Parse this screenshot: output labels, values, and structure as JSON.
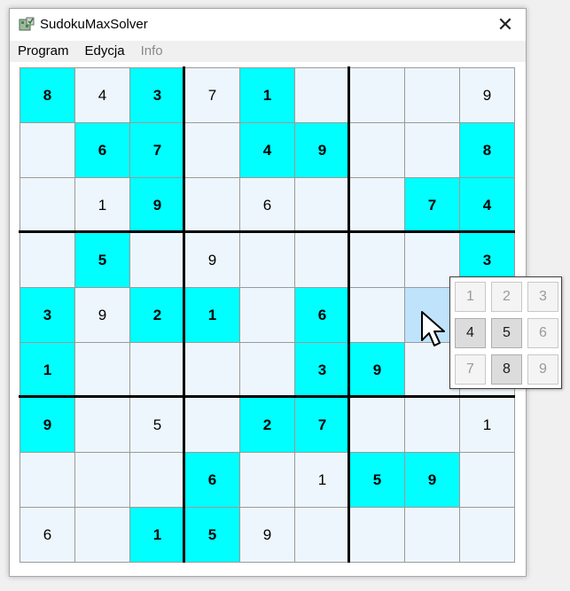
{
  "window": {
    "title": "SudokuMaxSolver",
    "close_glyph": "✕"
  },
  "menu": [
    {
      "label": "Program",
      "enabled": true
    },
    {
      "label": "Edycja",
      "enabled": true
    },
    {
      "label": "Info",
      "enabled": false
    }
  ],
  "colors": {
    "given_cell": "#00ffff",
    "empty_cell": "#eef6fd",
    "selected_cell": "#bfe3fb"
  },
  "board": {
    "rows": [
      [
        "8",
        "4",
        "3",
        "7",
        "1",
        "",
        "",
        "",
        "9"
      ],
      [
        "",
        "6",
        "7",
        "",
        "4",
        "9",
        "",
        "",
        "8"
      ],
      [
        "",
        "1",
        "9",
        "",
        "6",
        "",
        "",
        "7",
        "4"
      ],
      [
        "",
        "5",
        "",
        "9",
        "",
        "",
        "",
        "",
        "3"
      ],
      [
        "3",
        "9",
        "2",
        "1",
        "",
        "6",
        "",
        "",
        ""
      ],
      [
        "1",
        "",
        "",
        "",
        "",
        "3",
        "9",
        "",
        ""
      ],
      [
        "9",
        "",
        "5",
        "",
        "2",
        "7",
        "",
        "",
        "1"
      ],
      [
        "",
        "",
        "",
        "6",
        "",
        "1",
        "5",
        "9",
        ""
      ],
      [
        "6",
        "",
        "1",
        "5",
        "9",
        "",
        "",
        "",
        ""
      ]
    ],
    "given": [
      [
        1,
        0,
        1,
        0,
        1,
        0,
        0,
        0,
        0
      ],
      [
        0,
        1,
        1,
        0,
        1,
        1,
        0,
        0,
        1
      ],
      [
        0,
        0,
        1,
        0,
        0,
        0,
        0,
        1,
        1
      ],
      [
        0,
        1,
        0,
        0,
        0,
        0,
        0,
        0,
        1
      ],
      [
        1,
        0,
        1,
        1,
        0,
        1,
        0,
        0,
        0
      ],
      [
        1,
        0,
        0,
        0,
        0,
        1,
        1,
        0,
        0
      ],
      [
        1,
        0,
        0,
        0,
        1,
        1,
        0,
        0,
        0
      ],
      [
        0,
        0,
        0,
        1,
        0,
        0,
        1,
        1,
        0
      ],
      [
        0,
        0,
        1,
        1,
        0,
        0,
        0,
        0,
        0
      ]
    ],
    "selected_cell": {
      "row": 4,
      "col": 7
    }
  },
  "candidate_popup": {
    "digits": [
      "1",
      "2",
      "3",
      "4",
      "5",
      "6",
      "7",
      "8",
      "9"
    ],
    "enabled": [
      false,
      false,
      false,
      true,
      true,
      false,
      false,
      true,
      false
    ]
  },
  "icons": {
    "app": "sudoku-app-icon",
    "close": "close-icon",
    "pointer": "mouse-pointer-icon"
  }
}
